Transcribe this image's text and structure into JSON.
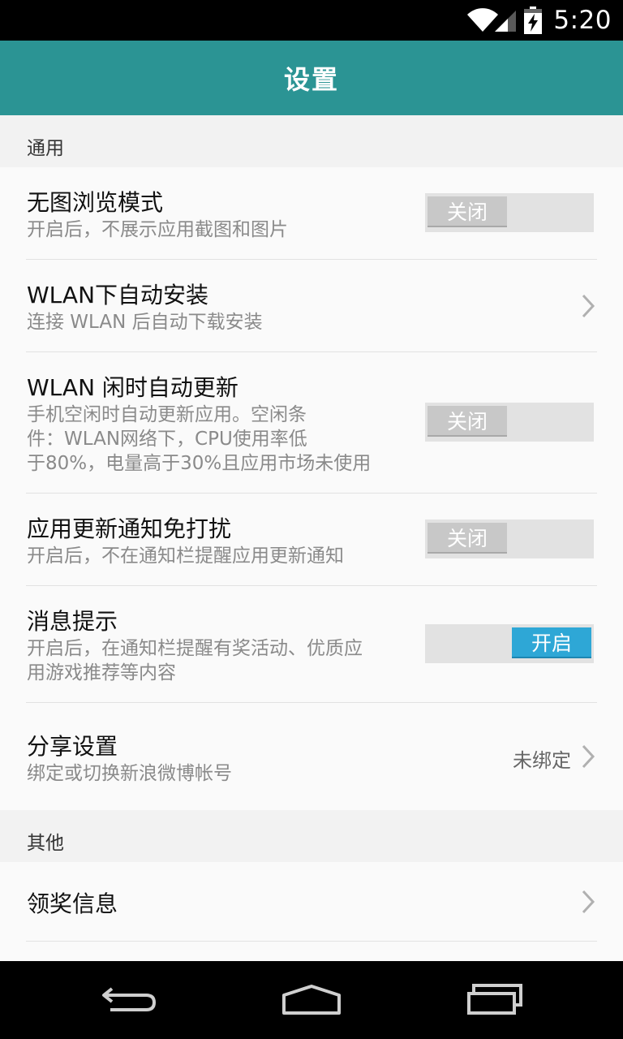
{
  "status_bar": {
    "time": "5:20",
    "icons": [
      "wifi-icon",
      "cell-signal-icon",
      "battery-charging-icon"
    ]
  },
  "app_bar": {
    "title": "设置"
  },
  "sections": [
    {
      "header": "通用",
      "items": [
        {
          "title": "无图浏览模式",
          "desc": "开启后，不展示应用截图和图片",
          "control": "toggle",
          "state": "关闭"
        },
        {
          "title": "WLAN下自动安装",
          "desc": "连接 WLAN 后自动下载安装",
          "control": "chevron"
        },
        {
          "title": "WLAN 闲时自动更新",
          "desc_lines": [
            "手机空闲时自动更新应用。空闲条",
            "件：WLAN网络下，CPU使用率低",
            "于80%，电量高于30%且应用市场未使用"
          ],
          "control": "toggle",
          "state": "关闭"
        },
        {
          "title": "应用更新通知免打扰",
          "desc": "开启后，不在通知栏提醒应用更新通知",
          "control": "toggle",
          "state": "关闭"
        },
        {
          "title": "消息提示",
          "desc_lines": [
            "开启后，在通知栏提醒有奖活动、优质应",
            "用游戏推荐等内容"
          ],
          "control": "toggle",
          "state": "开启"
        },
        {
          "title": "分享设置",
          "desc": "绑定或切换新浪微博帐号",
          "control": "chevron",
          "value": "未绑定"
        }
      ]
    },
    {
      "header": "其他",
      "items": [
        {
          "title": "领奖信息",
          "control": "chevron"
        }
      ]
    }
  ],
  "nav_bar": {
    "icons": [
      "back-icon",
      "home-icon",
      "recents-icon"
    ]
  },
  "colors": {
    "app_bar": "#2b9494",
    "toggle_on": "#2ea7d6",
    "toggle_off": "#c8c8c8"
  }
}
